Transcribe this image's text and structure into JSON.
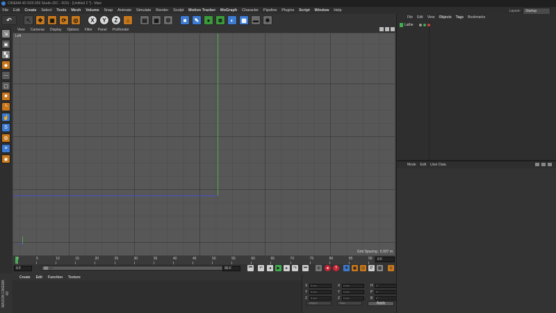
{
  "title_bar": {
    "title": "CINEMA 4D R20.059 Studio (RC - R20) - [Untitled 2 *] - Main"
  },
  "menu": {
    "items": [
      "File",
      "Edit",
      "Create",
      "Select",
      "Tools",
      "Mesh",
      "Volume",
      "Snap",
      "Animate",
      "Simulate",
      "Render",
      "Sculpt",
      "Motion Tracker",
      "MoGraph",
      "Character",
      "Pipeline",
      "Plugins",
      "Script",
      "Window",
      "Help"
    ],
    "bold": [
      "Create",
      "Tools",
      "Mesh",
      "Volume",
      "Motion Tracker",
      "MoGraph",
      "Script",
      "Window"
    ],
    "layout_label": "Layout:",
    "layout_value": "Startup"
  },
  "toolbar": {
    "axis_x": "X",
    "axis_y": "Y",
    "axis_z": "Z"
  },
  "viewport": {
    "menu": [
      "View",
      "Cameras",
      "Display",
      "Options",
      "Filter",
      "Panel",
      "ProRender"
    ],
    "view_name": "Left",
    "grid_spacing": "Grid Spacing : 5.937 m"
  },
  "timeline": {
    "ticks": [
      "0",
      "5",
      "10",
      "15",
      "20",
      "25",
      "30",
      "35",
      "40",
      "45",
      "50",
      "55",
      "60",
      "65",
      "70",
      "75",
      "80",
      "85",
      "90"
    ],
    "current_frame_right": "0 F",
    "start_frame": "0 F",
    "range_start": "0 F",
    "range_end": "90 F",
    "end_frame": "90 F"
  },
  "material_manager": {
    "menu": [
      "Create",
      "Edit",
      "Function",
      "Texture"
    ],
    "logo_text": "MAXON CINEMA 4D"
  },
  "coordinates": {
    "rows": [
      {
        "a": "X",
        "av": "0 cm",
        "b": "X",
        "bv": "0 cm",
        "c": "H",
        "cv": "0 °"
      },
      {
        "a": "Y",
        "av": "0 cm",
        "b": "Y",
        "bv": "0 cm",
        "c": "P",
        "cv": "0 °"
      },
      {
        "a": "Z",
        "av": "0 cm",
        "b": "Z",
        "bv": "0 cm",
        "c": "B",
        "cv": "0 °"
      }
    ],
    "mode": "Object",
    "size_mode": "Size",
    "apply": "Apply"
  },
  "object_manager": {
    "menu": [
      "File",
      "Edit",
      "View",
      "Objects",
      "Tags",
      "Bookmarks"
    ],
    "bold": [
      "Objects",
      "Tags"
    ],
    "objects": [
      {
        "name": "Lathe"
      }
    ]
  },
  "attribute_manager": {
    "menu": [
      "Mode",
      "Edit",
      "User Data"
    ]
  }
}
